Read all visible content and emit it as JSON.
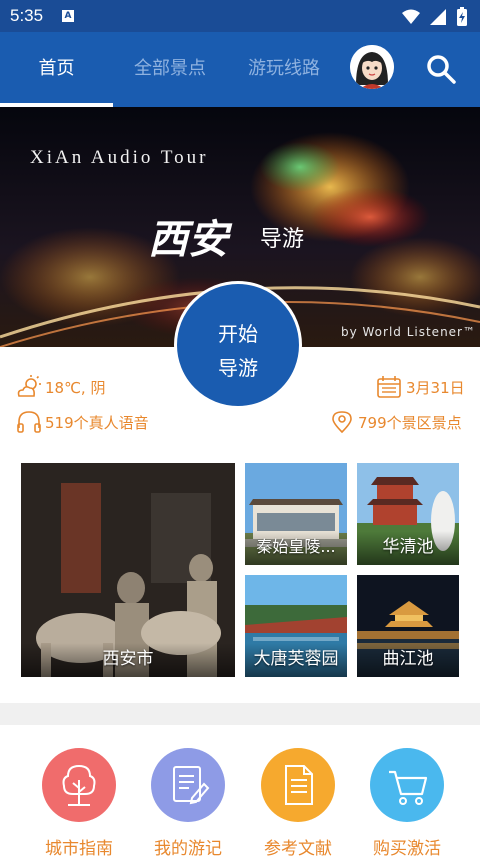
{
  "status_bar": {
    "time": "5:35",
    "notification_icon": "A"
  },
  "nav": {
    "tabs": [
      {
        "label": "首页",
        "active": true
      },
      {
        "label": "全部景点",
        "active": false
      },
      {
        "label": "游玩线路",
        "active": false
      }
    ]
  },
  "banner": {
    "title_en": "XiAn Audio Tour",
    "title_cn": "西安",
    "subtitle_cn": "导游",
    "credit": "by World Listener™"
  },
  "start_button": {
    "line1": "开始",
    "line2": "导游"
  },
  "info": {
    "weather": "18℃, 阴",
    "date": "3月31日",
    "audio_count": "519个真人语音",
    "spot_count": "799个景区景点"
  },
  "tiles": [
    {
      "label": "西安市"
    },
    {
      "label": "秦始皇陵..."
    },
    {
      "label": "华清池"
    },
    {
      "label": "大唐芙蓉园"
    },
    {
      "label": "曲江池"
    }
  ],
  "bottom_menu": [
    {
      "label": "城市指南",
      "icon": "tree-icon",
      "color": "#f06c6c"
    },
    {
      "label": "我的游记",
      "icon": "notes-icon",
      "color": "#8e9be6"
    },
    {
      "label": "参考文献",
      "icon": "document-icon",
      "color": "#f6a92e"
    },
    {
      "label": "购买激活",
      "icon": "cart-icon",
      "color": "#4ab8ee"
    }
  ],
  "colors": {
    "primary": "#1a5cb0",
    "status_bar": "#1a4c96",
    "accent": "#e8882e"
  }
}
